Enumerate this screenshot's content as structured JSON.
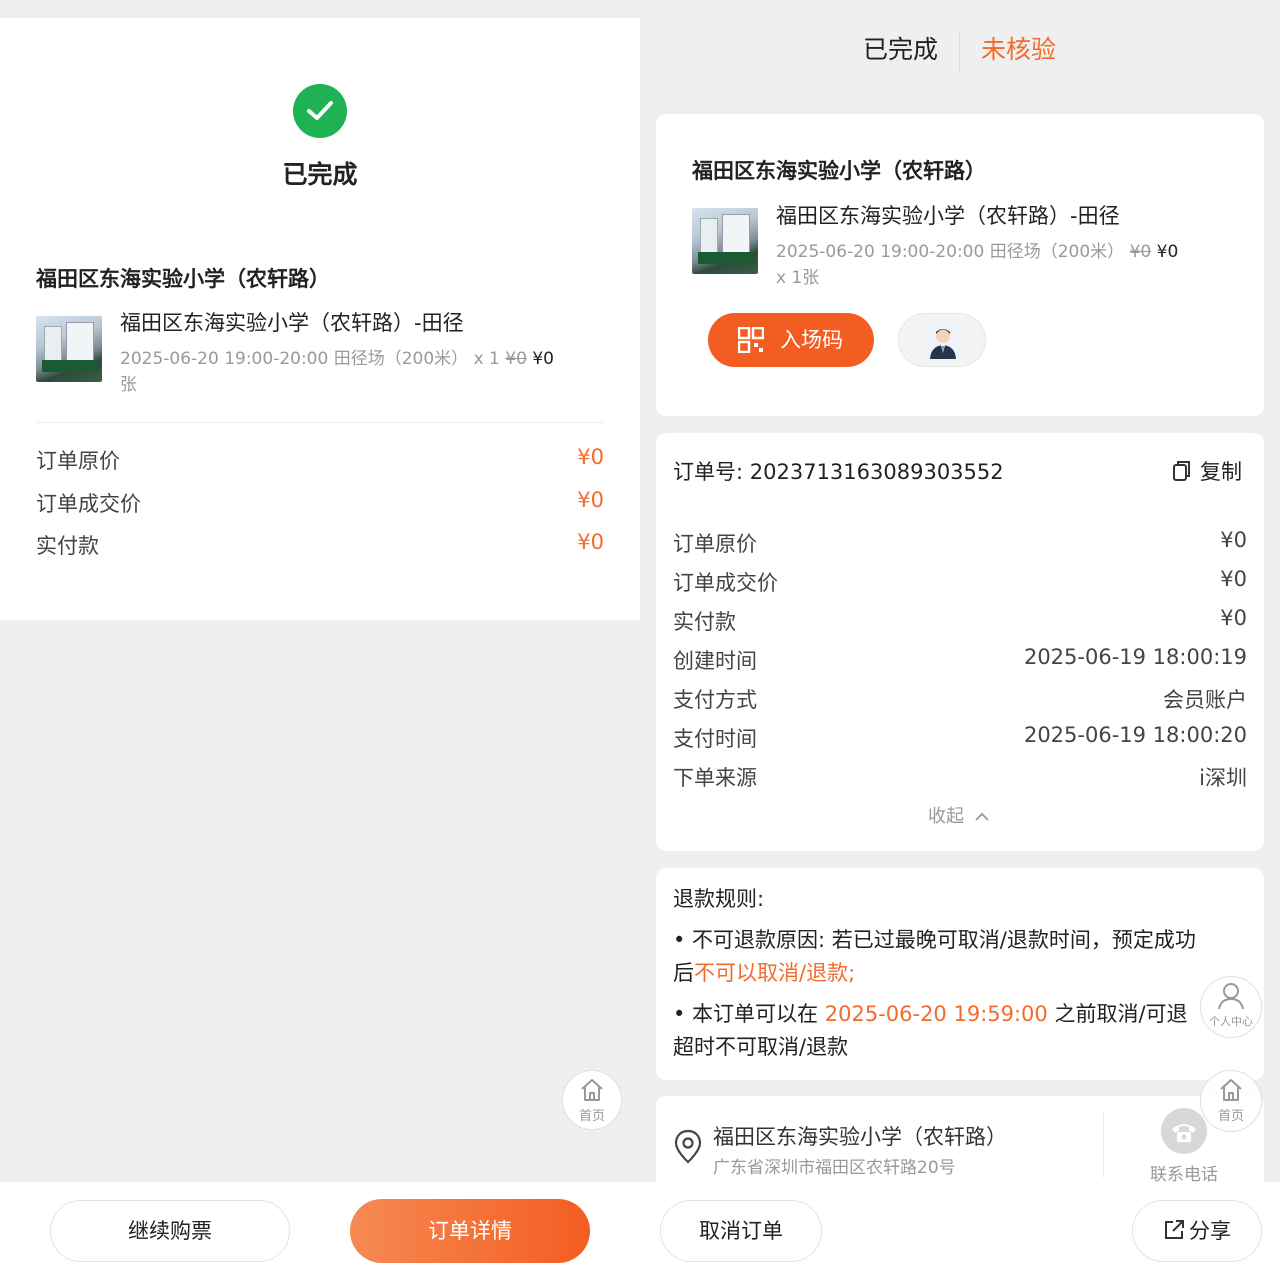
{
  "left": {
    "status_title": "已完成",
    "venue_title": "福田区东海实验小学（农轩路）",
    "product": {
      "name": "福田区东海实验小学（农轩路）-田径",
      "meta": "2025-06-20 19:00-20:00 田径场（200米） x 1",
      "original_price": "¥0",
      "price": "¥0",
      "unit": "张"
    },
    "prices": [
      {
        "label": "订单原价",
        "value": "¥0"
      },
      {
        "label": "订单成交价",
        "value": "¥0"
      },
      {
        "label": "实付款",
        "value": "¥0"
      }
    ],
    "home_label": "首页",
    "buttons": {
      "continue": "继续购票",
      "details": "订单详情"
    }
  },
  "right": {
    "tabs": [
      {
        "label": "已完成",
        "active": false
      },
      {
        "label": "未核验",
        "active": true
      }
    ],
    "venue_title": "福田区东海实验小学（农轩路）",
    "product": {
      "name": "福田区东海实验小学（农轩路）-田径",
      "meta": "2025-06-20 19:00-20:00 田径场（200米）",
      "original_price": "¥0",
      "price": "¥0",
      "qty": "x 1张"
    },
    "entry_code_label": "入场码",
    "order": {
      "number_label": "订单号:",
      "number": "2023713163089303552",
      "copy_label": "复制",
      "rows": [
        {
          "label": "订单原价",
          "value": "¥0"
        },
        {
          "label": "订单成交价",
          "value": "¥0"
        },
        {
          "label": "实付款",
          "value": "¥0"
        },
        {
          "label": "创建时间",
          "value": "2025-06-19 18:00:19"
        },
        {
          "label": "支付方式",
          "value": "会员账户"
        },
        {
          "label": "支付时间",
          "value": "2025-06-19 18:00:20"
        },
        {
          "label": "下单来源",
          "value": "i深圳"
        }
      ],
      "collapse_label": "收起"
    },
    "refund": {
      "title": "退款规则:",
      "line1": "• 不可退款原因: 若已过最晚可取消/退款时间，预定成功",
      "line2_pre": "后",
      "line2_highlight": "不可以取消/退款;",
      "line3_pre": "• 本订单可以在 ",
      "line3_highlight": "2025-06-20 19:59:00",
      "line3_post": " 之前取消/可退",
      "line4": "超时不可取消/退款"
    },
    "location": {
      "name": "福田区东海实验小学（农轩路）",
      "address": "广东省深圳市福田区农轩路20号",
      "phone_label": "联系电话"
    },
    "personal_center_label": "个人中心",
    "home_label": "首页",
    "buttons": {
      "cancel": "取消订单",
      "share": "分享"
    }
  },
  "colors": {
    "accent": "#f36b2c",
    "success": "#1fb255"
  }
}
